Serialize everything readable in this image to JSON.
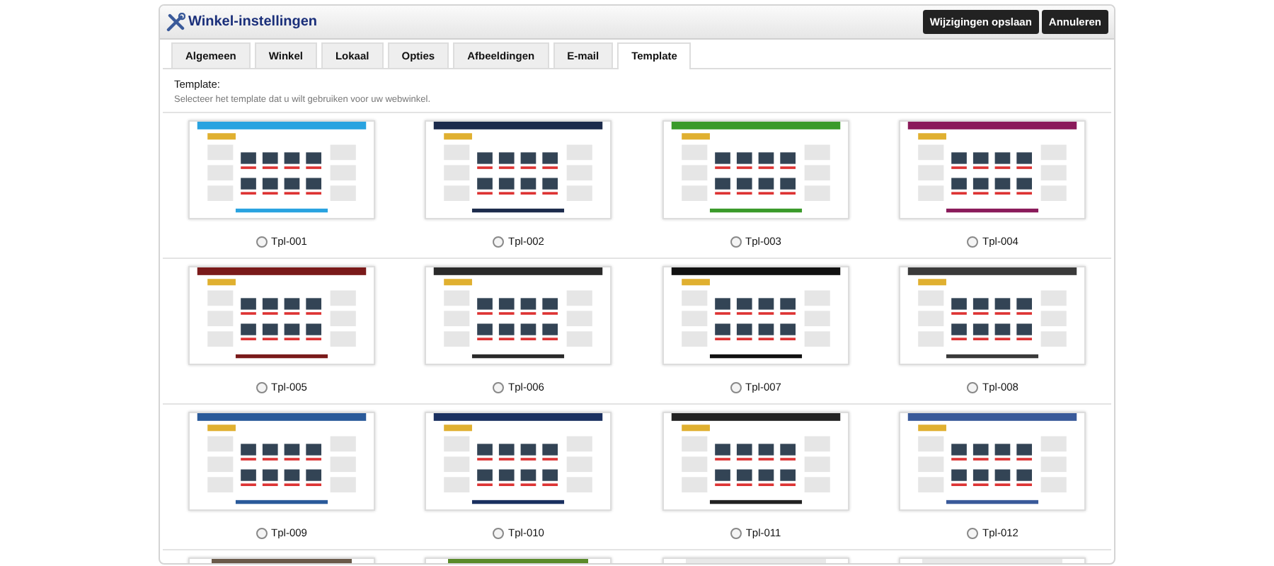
{
  "window": {
    "title": "Winkel-instellingen"
  },
  "buttons": [
    "Wijzigingen opslaan",
    "Annuleren"
  ],
  "tabs": [
    {
      "label": "Algemeen",
      "selected": false
    },
    {
      "label": "Winkel",
      "selected": false
    },
    {
      "label": "Lokaal",
      "selected": false
    },
    {
      "label": "Opties",
      "selected": false
    },
    {
      "label": "Afbeeldingen",
      "selected": false
    },
    {
      "label": "E-mail",
      "selected": false
    },
    {
      "label": "Template",
      "selected": true
    }
  ],
  "section": {
    "title": "Template:",
    "description": "Selecteer het template dat u wilt gebruiken voor uw webwinkel."
  },
  "templates": [
    {
      "label": "Tpl-001",
      "selected": false,
      "color": "#29a3e0"
    },
    {
      "label": "Tpl-002",
      "selected": false,
      "color": "#1c2b4c"
    },
    {
      "label": "Tpl-003",
      "selected": false,
      "color": "#3a9a2a"
    },
    {
      "label": "Tpl-004",
      "selected": false,
      "color": "#8a1a5a"
    },
    {
      "label": "Tpl-005",
      "selected": false,
      "color": "#7a1a1a"
    },
    {
      "label": "Tpl-006",
      "selected": false,
      "color": "#2a2a2a"
    },
    {
      "label": "Tpl-007",
      "selected": false,
      "color": "#111111"
    },
    {
      "label": "Tpl-008",
      "selected": false,
      "color": "#3a3a3a"
    },
    {
      "label": "Tpl-009",
      "selected": false,
      "color": "#2a5a9a"
    },
    {
      "label": "Tpl-010",
      "selected": false,
      "color": "#1a3060"
    },
    {
      "label": "Tpl-011",
      "selected": false,
      "color": "#222222"
    },
    {
      "label": "Tpl-012",
      "selected": false,
      "color": "#3a5a9a"
    },
    {
      "color": "#6a5a4a"
    },
    {
      "color": "#5a8a2a"
    },
    {
      "color": "#e8e8e8"
    },
    {
      "color": "#e8e8e8"
    }
  ]
}
